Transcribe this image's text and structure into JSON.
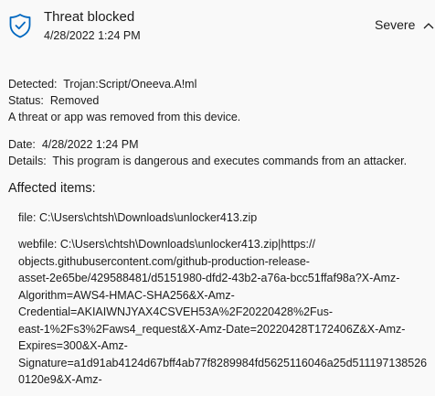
{
  "header": {
    "title": "Threat blocked",
    "datetime": "4/28/2022 1:24 PM",
    "severity": "Severe",
    "shield_icon": "shield-icon",
    "accent_color": "#0067c0"
  },
  "details": {
    "detected_label": "Detected:",
    "detected_value": "Trojan:Script/Oneeva.A!ml",
    "status_label": "Status:",
    "status_value": "Removed",
    "status_message": "A threat or app was removed from this device.",
    "date_label": "Date:",
    "date_value": "4/28/2022 1:24 PM",
    "details_label": "Details:",
    "details_value": "This program is dangerous and executes commands from an attacker."
  },
  "affected": {
    "heading": "Affected items:",
    "file_label": "file:",
    "file_value": "C:\\Users\\chtsh\\Downloads\\unlocker413.zip",
    "webfile_label": "webfile:",
    "webfile_lines": [
      "C:\\Users\\chtsh\\Downloads\\unlocker413.zip|https://",
      "objects.githubusercontent.com/github-production-release-",
      "asset-2e65be/429588481/d5151980-dfd2-43b2-a76a-bcc51ffaf98a?X-Amz-",
      "Algorithm=AWS4-HMAC-SHA256&X-Amz-",
      "Credential=AKIAIWNJYAX4CSVEH53A%2F20220428%2Fus-",
      "east-1%2Fs3%2Faws4_request&X-Amz-Date=20220428T172406Z&X-Amz-",
      "Expires=300&X-Amz-",
      "Signature=a1d91ab4124d67bff4ab77f8289984fd5625116046a25d511197138526",
      "0120e9&X-Amz-"
    ]
  }
}
